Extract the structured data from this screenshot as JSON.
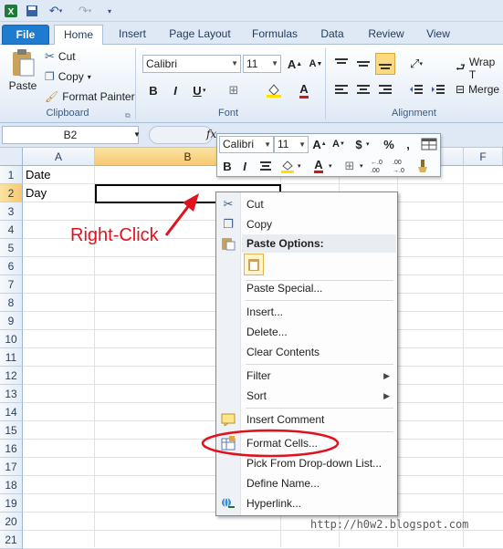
{
  "qat": {
    "undo_icon": "undo-icon",
    "redo_icon": "redo-icon"
  },
  "tabs": [
    "File",
    "Home",
    "Insert",
    "Page Layout",
    "Formulas",
    "Data",
    "Review",
    "View"
  ],
  "ribbon": {
    "clipboard": {
      "paste": "Paste",
      "cut": "Cut",
      "copy": "Copy",
      "format_painter": "Format Painter",
      "label": "Clipboard"
    },
    "font": {
      "name": "Calibri",
      "size": "11",
      "label": "Font",
      "bold": "B",
      "italic": "I",
      "underline": "U"
    },
    "alignment": {
      "wrap": "Wrap T",
      "merge": "Merge",
      "label": "Alignment"
    }
  },
  "formula_bar": {
    "name_box": "B2",
    "fx": "fx"
  },
  "columns": [
    "A",
    "B",
    "C",
    "D",
    "E",
    "F"
  ],
  "rows": [
    "1",
    "2",
    "3",
    "4",
    "5",
    "6",
    "7",
    "8",
    "9",
    "10",
    "11",
    "12",
    "13",
    "14",
    "15",
    "16",
    "17",
    "18",
    "19",
    "20",
    "21"
  ],
  "cells": {
    "A1": "Date",
    "A2": "Day"
  },
  "mini_toolbar": {
    "font": "Calibri",
    "size": "11",
    "dollar": "$",
    "percent": "%",
    "comma": ",",
    "bold": "B",
    "italic": "I",
    "dec_inc": "+.0\n.00",
    "dec_dec": ".00\n→.0"
  },
  "context_menu": {
    "cut": "Cut",
    "copy": "Copy",
    "paste_header": "Paste Options:",
    "paste_special": "Paste Special...",
    "insert": "Insert...",
    "delete": "Delete...",
    "clear": "Clear Contents",
    "filter": "Filter",
    "sort": "Sort",
    "insert_comment": "Insert Comment",
    "format_cells": "Format Cells...",
    "pick_list": "Pick From Drop-down List...",
    "define_name": "Define Name...",
    "hyperlink": "Hyperlink..."
  },
  "annotation": {
    "label": "Right-Click",
    "color": "#e0121f"
  },
  "watermark": "http://h0w2.blogspot.com",
  "colors": {
    "file_tab": "#1e7bd0",
    "selection_header": "#f6c970",
    "ribbon_bg": "#dfe9f5"
  }
}
